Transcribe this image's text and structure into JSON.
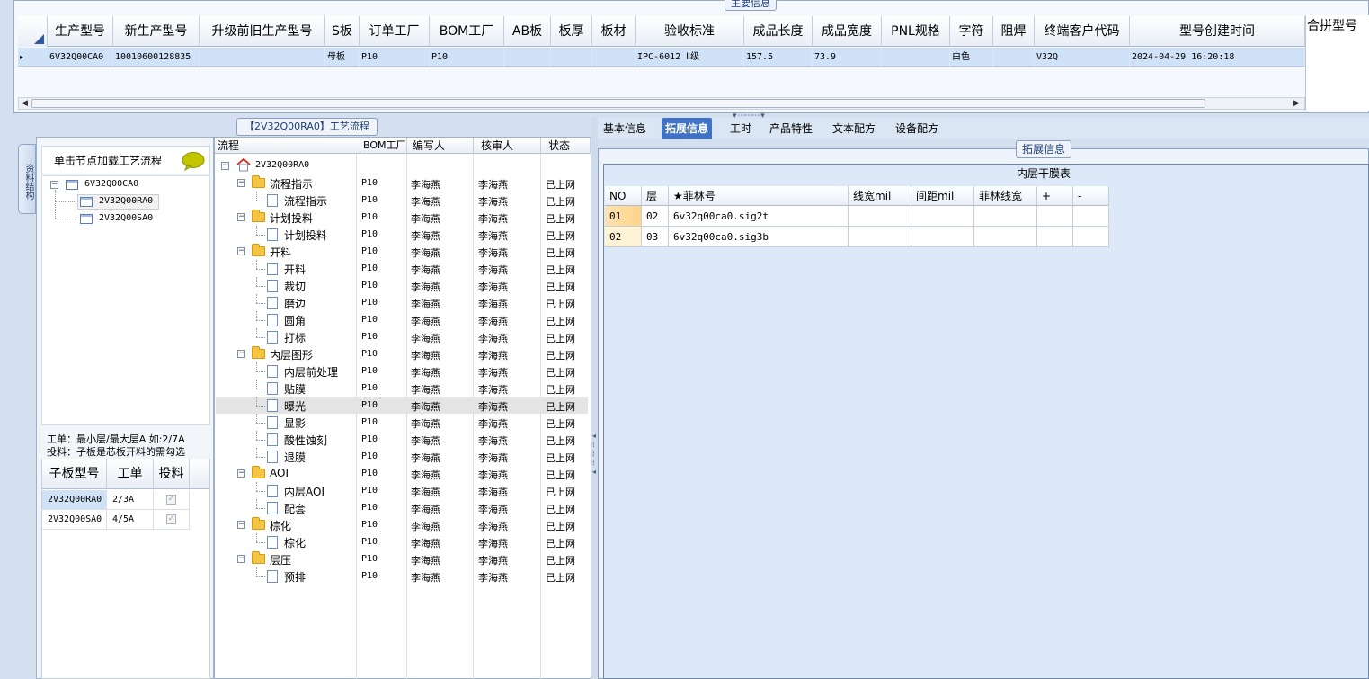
{
  "main_info": {
    "title": "主要信息",
    "columns": [
      "生产型号",
      "新生产型号",
      "升级前旧生产型号",
      "S板",
      "订单工厂",
      "BOM工厂",
      "AB板",
      "板厚",
      "板材",
      "验收标准",
      "成品长度",
      "成品宽度",
      "PNL规格",
      "字符",
      "阻焊",
      "终端客户代码",
      "型号创建时间"
    ],
    "row": [
      "6V32Q00CA0",
      "10010600128835",
      "",
      "母板",
      "P10",
      "P10",
      "",
      "",
      "",
      "IPC-6012 Ⅱ级",
      "157.5",
      "73.9",
      "",
      "白色",
      "",
      "V32Q",
      "2024-04-29 16:20:18"
    ],
    "row_indicator": "▸",
    "merge_header": "合拼型号"
  },
  "left_panel": {
    "vertical_tab": "资料结构",
    "header": "单击节点加载工艺流程",
    "tree": {
      "root": "6V32Q00CA0",
      "children": [
        "2V32Q00RA0",
        "2V32Q00SA0"
      ]
    },
    "note_line1": "工单：最小层/最大层A 如:2/7A",
    "note_line2": "投料：子板是芯板开料的需勾选",
    "sub_table": {
      "headers": [
        "子板型号",
        "工单",
        "投料"
      ],
      "rows": [
        {
          "model": "2V32Q00RA0",
          "work_order": "2/3A",
          "feed": "✓"
        },
        {
          "model": "2V32Q00SA0",
          "work_order": "4/5A",
          "feed": "✓"
        }
      ]
    }
  },
  "flow_panel": {
    "title": "【2V32Q00RA0】工艺流程",
    "headers": [
      "流程",
      "BOM工厂",
      "编写人",
      "核审人",
      "状态"
    ],
    "root": "2V32Q00RA0",
    "rows": [
      {
        "name": "流程指示",
        "kind": "folder",
        "bom": "P10",
        "writer": "李海燕",
        "reviewer": "李海燕",
        "status": "已上网"
      },
      {
        "name": "流程指示",
        "kind": "leaf",
        "bom": "P10",
        "writer": "李海燕",
        "reviewer": "李海燕",
        "status": "已上网"
      },
      {
        "name": "计划投料",
        "kind": "folder",
        "bom": "P10",
        "writer": "李海燕",
        "reviewer": "李海燕",
        "status": "已上网"
      },
      {
        "name": "计划投料",
        "kind": "leaf",
        "bom": "P10",
        "writer": "李海燕",
        "reviewer": "李海燕",
        "status": "已上网"
      },
      {
        "name": "开料",
        "kind": "folder",
        "bom": "P10",
        "writer": "李海燕",
        "reviewer": "李海燕",
        "status": "已上网"
      },
      {
        "name": "开料",
        "kind": "leaf",
        "bom": "P10",
        "writer": "李海燕",
        "reviewer": "李海燕",
        "status": "已上网"
      },
      {
        "name": "裁切",
        "kind": "leaf",
        "bom": "P10",
        "writer": "李海燕",
        "reviewer": "李海燕",
        "status": "已上网"
      },
      {
        "name": "磨边",
        "kind": "leaf",
        "bom": "P10",
        "writer": "李海燕",
        "reviewer": "李海燕",
        "status": "已上网"
      },
      {
        "name": "圆角",
        "kind": "leaf",
        "bom": "P10",
        "writer": "李海燕",
        "reviewer": "李海燕",
        "status": "已上网"
      },
      {
        "name": "打标",
        "kind": "leaf",
        "bom": "P10",
        "writer": "李海燕",
        "reviewer": "李海燕",
        "status": "已上网"
      },
      {
        "name": "内层图形",
        "kind": "folder",
        "bom": "P10",
        "writer": "李海燕",
        "reviewer": "李海燕",
        "status": "已上网"
      },
      {
        "name": "内层前处理",
        "kind": "leaf",
        "bom": "P10",
        "writer": "李海燕",
        "reviewer": "李海燕",
        "status": "已上网"
      },
      {
        "name": "贴膜",
        "kind": "leaf",
        "bom": "P10",
        "writer": "李海燕",
        "reviewer": "李海燕",
        "status": "已上网"
      },
      {
        "name": "曝光",
        "kind": "leaf",
        "bom": "P10",
        "writer": "李海燕",
        "reviewer": "李海燕",
        "status": "已上网",
        "selected": true
      },
      {
        "name": "显影",
        "kind": "leaf",
        "bom": "P10",
        "writer": "李海燕",
        "reviewer": "李海燕",
        "status": "已上网"
      },
      {
        "name": "酸性蚀刻",
        "kind": "leaf",
        "bom": "P10",
        "writer": "李海燕",
        "reviewer": "李海燕",
        "status": "已上网"
      },
      {
        "name": "退膜",
        "kind": "leaf",
        "bom": "P10",
        "writer": "李海燕",
        "reviewer": "李海燕",
        "status": "已上网"
      },
      {
        "name": "AOI",
        "kind": "folder",
        "bom": "P10",
        "writer": "李海燕",
        "reviewer": "李海燕",
        "status": "已上网"
      },
      {
        "name": "内层AOI",
        "kind": "leaf",
        "bom": "P10",
        "writer": "李海燕",
        "reviewer": "李海燕",
        "status": "已上网"
      },
      {
        "name": "配套",
        "kind": "leaf",
        "bom": "P10",
        "writer": "李海燕",
        "reviewer": "李海燕",
        "status": "已上网"
      },
      {
        "name": "棕化",
        "kind": "folder",
        "bom": "P10",
        "writer": "李海燕",
        "reviewer": "李海燕",
        "status": "已上网"
      },
      {
        "name": "棕化",
        "kind": "leaf",
        "bom": "P10",
        "writer": "李海燕",
        "reviewer": "李海燕",
        "status": "已上网"
      },
      {
        "name": "层压",
        "kind": "folder",
        "bom": "P10",
        "writer": "李海燕",
        "reviewer": "李海燕",
        "status": "已上网"
      },
      {
        "name": "预排",
        "kind": "leaf",
        "bom": "P10",
        "writer": "李海燕",
        "reviewer": "李海燕",
        "status": "已上网"
      }
    ]
  },
  "tabs": [
    {
      "label": "基本信息",
      "active": false
    },
    {
      "label": "拓展信息",
      "active": true
    },
    {
      "label": "工时",
      "active": false
    },
    {
      "label": "产品特性",
      "active": false
    },
    {
      "label": "文本配方",
      "active": false
    },
    {
      "label": "设备配方",
      "active": false
    }
  ],
  "ext": {
    "title": "拓展信息",
    "film_table_title": "内层干膜表",
    "headers": [
      "NO",
      "层",
      "★菲林号",
      "线宽mil",
      "间距mil",
      "菲林线宽",
      "+",
      "-"
    ],
    "rows": [
      {
        "no": "01",
        "layer": "02",
        "film": "6v32q00ca0.sig2t",
        "line_width": "",
        "spacing": "",
        "film_width": ""
      },
      {
        "no": "02",
        "layer": "03",
        "film": "6v32q00ca0.sig3b",
        "line_width": "",
        "spacing": "",
        "film_width": ""
      }
    ]
  },
  "colors": {
    "selected_row": "#cfe2f7",
    "active_tab": "#3f72c7",
    "folder": "#f5c542",
    "panel_border": "#8aa0c0"
  }
}
